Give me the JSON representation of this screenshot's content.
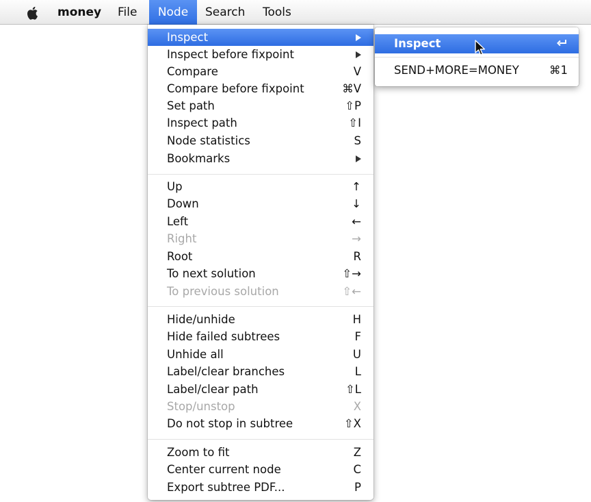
{
  "menubar": {
    "apple_icon": "apple-icon",
    "items": [
      {
        "label": "money"
      },
      {
        "label": "File"
      },
      {
        "label": "Node"
      },
      {
        "label": "Search"
      },
      {
        "label": "Tools"
      }
    ]
  },
  "node_menu": {
    "items": [
      {
        "label": "Inspect",
        "shortcut": "",
        "submenu": true
      },
      {
        "label": "Inspect before fixpoint",
        "shortcut": "",
        "submenu": true
      },
      {
        "label": "Compare",
        "shortcut": "V"
      },
      {
        "label": "Compare before fixpoint",
        "shortcut": "⌘V"
      },
      {
        "label": "Set path",
        "shortcut": "⇧P"
      },
      {
        "label": "Inspect path",
        "shortcut": "⇧I"
      },
      {
        "label": "Node statistics",
        "shortcut": "S"
      },
      {
        "label": "Bookmarks",
        "shortcut": "",
        "submenu": true
      },
      {
        "label": "Up",
        "shortcut": "↑"
      },
      {
        "label": "Down",
        "shortcut": "↓"
      },
      {
        "label": "Left",
        "shortcut": "←"
      },
      {
        "label": "Right",
        "shortcut": "→"
      },
      {
        "label": "Root",
        "shortcut": "R"
      },
      {
        "label": "To next solution",
        "shortcut": "⇧→"
      },
      {
        "label": "To previous solution",
        "shortcut": "⇧←"
      },
      {
        "label": "Hide/unhide",
        "shortcut": "H"
      },
      {
        "label": "Hide failed subtrees",
        "shortcut": "F"
      },
      {
        "label": "Unhide all",
        "shortcut": "U"
      },
      {
        "label": "Label/clear branches",
        "shortcut": "L"
      },
      {
        "label": "Label/clear path",
        "shortcut": "⇧L"
      },
      {
        "label": "Stop/unstop",
        "shortcut": "X"
      },
      {
        "label": "Do not stop in subtree",
        "shortcut": "⇧X"
      },
      {
        "label": "Zoom to fit",
        "shortcut": "Z"
      },
      {
        "label": "Center current node",
        "shortcut": "C"
      },
      {
        "label": "Export subtree PDF...",
        "shortcut": "P"
      }
    ]
  },
  "inspect_submenu": {
    "items": [
      {
        "label": "Inspect",
        "shortcut_icon": "return-icon"
      },
      {
        "label": "SEND+MORE=MONEY",
        "shortcut": "⌘1"
      }
    ]
  },
  "colors": {
    "highlight": "#3a78e8",
    "disabled_text": "#a8a8a8",
    "separator": "#e2e2e2"
  }
}
